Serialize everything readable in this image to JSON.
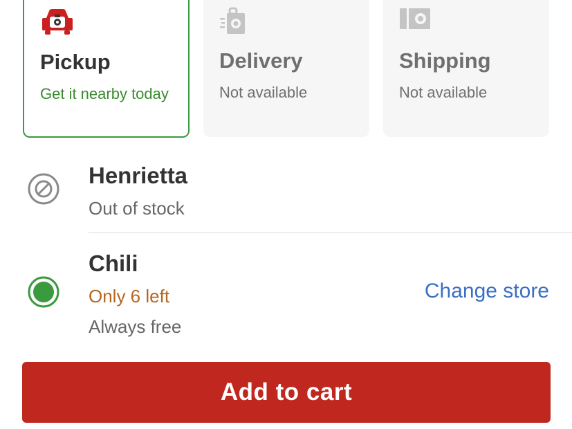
{
  "fulfillment": {
    "options": [
      {
        "title": "Pickup",
        "subtitle": "Get it nearby today",
        "icon": "pickup-car-icon",
        "selected": true
      },
      {
        "title": "Delivery",
        "subtitle": "Not available",
        "icon": "delivery-bag-icon",
        "selected": false
      },
      {
        "title": "Shipping",
        "subtitle": "Not available",
        "icon": "shipping-box-icon",
        "selected": false
      }
    ]
  },
  "stores": [
    {
      "name": "Henrietta",
      "status": "Out of stock",
      "icon": "unavailable-icon"
    },
    {
      "name": "Chili",
      "stock": "Only 6 left",
      "fee": "Always free",
      "icon": "radio-selected-icon"
    }
  ],
  "change_store_label": "Change store",
  "add_to_cart_label": "Add to cart",
  "colors": {
    "accent_red": "#c0281f",
    "success_green": "#3a9a3e",
    "low_stock_orange": "#b5651d",
    "link_blue": "#3b6fc4"
  }
}
